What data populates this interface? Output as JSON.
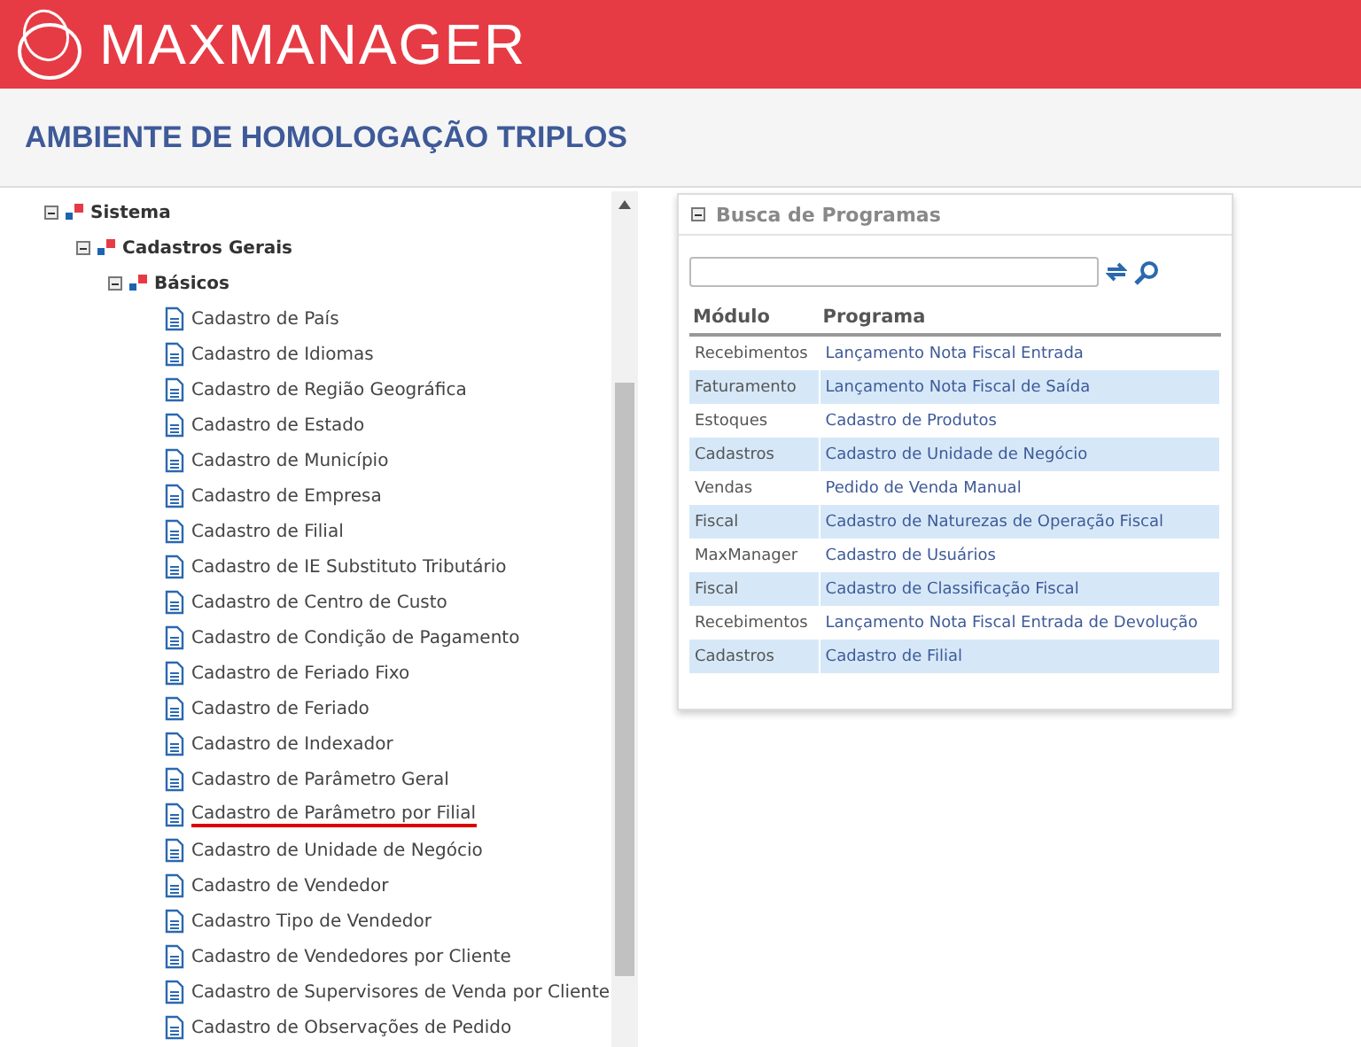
{
  "header": {
    "logo_text": "MAXMANAGER"
  },
  "page_title": "AMBIENTE DE HOMOLOGAÇÃO TRIPLOS",
  "tree": [
    {
      "kind": "folder",
      "label": "Sistema",
      "expanded": true,
      "children": [
        {
          "kind": "folder",
          "label": "Cadastros Gerais",
          "expanded": true,
          "children": [
            {
              "kind": "folder",
              "label": "Básicos",
              "expanded": true,
              "children": [
                {
                  "kind": "program",
                  "label": "Cadastro de País",
                  "underlined": false
                },
                {
                  "kind": "program",
                  "label": "Cadastro de Idiomas",
                  "underlined": false
                },
                {
                  "kind": "program",
                  "label": "Cadastro de Região Geográfica",
                  "underlined": false
                },
                {
                  "kind": "program",
                  "label": "Cadastro de Estado",
                  "underlined": false
                },
                {
                  "kind": "program",
                  "label": "Cadastro de Município",
                  "underlined": false
                },
                {
                  "kind": "program",
                  "label": "Cadastro de Empresa",
                  "underlined": false
                },
                {
                  "kind": "program",
                  "label": "Cadastro de Filial",
                  "underlined": false
                },
                {
                  "kind": "program",
                  "label": "Cadastro de IE Substituto Tributário",
                  "underlined": false
                },
                {
                  "kind": "program",
                  "label": "Cadastro de Centro de Custo",
                  "underlined": false
                },
                {
                  "kind": "program",
                  "label": "Cadastro de Condição de Pagamento",
                  "underlined": false
                },
                {
                  "kind": "program",
                  "label": "Cadastro de Feriado Fixo",
                  "underlined": false
                },
                {
                  "kind": "program",
                  "label": "Cadastro de Feriado",
                  "underlined": false
                },
                {
                  "kind": "program",
                  "label": "Cadastro de Indexador",
                  "underlined": false
                },
                {
                  "kind": "program",
                  "label": "Cadastro de Parâmetro Geral",
                  "underlined": false
                },
                {
                  "kind": "program",
                  "label": "Cadastro de Parâmetro por Filial",
                  "underlined": true
                },
                {
                  "kind": "program",
                  "label": "Cadastro de Unidade de Negócio",
                  "underlined": false
                },
                {
                  "kind": "program",
                  "label": "Cadastro de Vendedor",
                  "underlined": false
                },
                {
                  "kind": "program",
                  "label": "Cadastro Tipo de Vendedor",
                  "underlined": false
                },
                {
                  "kind": "program",
                  "label": "Cadastro de Vendedores por Cliente",
                  "underlined": false
                },
                {
                  "kind": "program",
                  "label": "Cadastro de Supervisores de Venda por Cliente",
                  "underlined": false
                },
                {
                  "kind": "program",
                  "label": "Cadastro de Observações de Pedido",
                  "underlined": false
                }
              ]
            }
          ]
        }
      ]
    }
  ],
  "search_panel": {
    "title": "Busca de Programas",
    "expanded": true,
    "columns": [
      "Módulo",
      "Programa"
    ],
    "rows": [
      [
        "Recebimentos",
        "Lançamento Nota Fiscal Entrada"
      ],
      [
        "Faturamento",
        "Lançamento Nota Fiscal de Saída"
      ],
      [
        "Estoques",
        "Cadastro de Produtos"
      ],
      [
        "Cadastros",
        "Cadastro de Unidade de Negócio"
      ],
      [
        "Vendas",
        "Pedido de Venda Manual"
      ],
      [
        "Fiscal",
        "Cadastro de Naturezas de Operação Fiscal"
      ],
      [
        "MaxManager",
        "Cadastro de Usuários"
      ],
      [
        "Fiscal",
        "Cadastro de Classificação Fiscal"
      ],
      [
        "Recebimentos",
        "Lançamento Nota Fiscal Entrada de Devolução"
      ],
      [
        "Cadastros",
        "Cadastro de Filial"
      ]
    ]
  }
}
